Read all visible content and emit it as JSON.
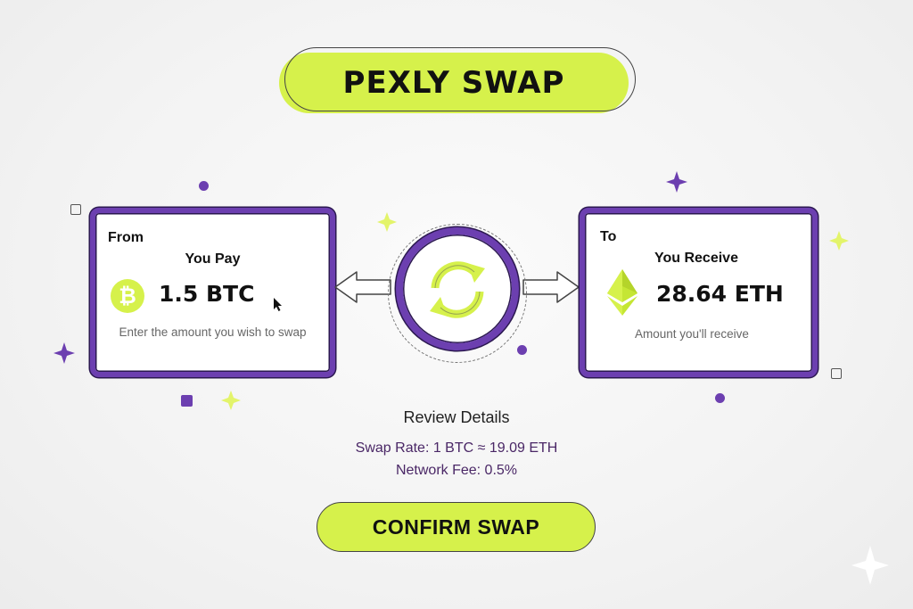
{
  "header": {
    "title": "PEXLY SWAP"
  },
  "from_card": {
    "corner_label": "From",
    "heading": "You Pay",
    "coin_symbol": "₿",
    "amount": "1.5 BTC",
    "hint": "Enter the amount you wish to swap"
  },
  "to_card": {
    "corner_label": "To",
    "heading": "You Receive",
    "amount": "28.64 ETH",
    "hint": "Amount you'll receive"
  },
  "review": {
    "title": "Review Details",
    "swap_rate": "Swap Rate: 1 BTC ≈ 19.09 ETH",
    "network_fee": "Network Fee: 0.5%"
  },
  "actions": {
    "confirm_label": "CONFIRM SWAP"
  },
  "colors": {
    "accent_lime": "#d6f14b",
    "accent_purple": "#6c3fb0",
    "text_purple": "#4a2766"
  },
  "icons": [
    "bitcoin-icon",
    "ethereum-icon",
    "swap-arrows-icon",
    "arrow-left-icon",
    "arrow-right-icon",
    "cursor-icon",
    "sparkle-icon"
  ]
}
